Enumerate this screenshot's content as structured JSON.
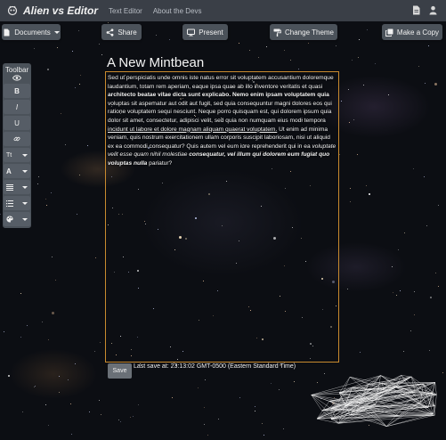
{
  "nav": {
    "brand": "Alien vs Editor",
    "links": [
      "Text Editor",
      "About the Devs"
    ],
    "icons": [
      "document-icon",
      "user-icon"
    ]
  },
  "actions": {
    "documents": "Documents",
    "share": "Share",
    "present": "Present",
    "change_theme": "Change Theme",
    "make_copy": "Make a Copy"
  },
  "toolbar": {
    "title": "Toolbar",
    "bold": "B",
    "italic": "I",
    "underline": "U",
    "font_size": "Tt",
    "font_color": "A"
  },
  "document": {
    "title": "A New Mintbean",
    "segments": [
      {
        "style": "normal",
        "text": "Sed ut perspiciatis unde omnis iste natus error sit voluptatem accusantium doloremque laudantium, totam rem aperiam, eaque ipsa quae ab illo inventore veritatis et quasi "
      },
      {
        "style": "bold",
        "text": "architecto beatae vitae dicta sunt explicabo. Nemo enim ipsam voluptatem quia"
      },
      {
        "style": "normal",
        "text": " voluptas sit aspernatur aut odit aut fugit, sed quia consequuntur magni dolores eos qui ratione voluptatem sequi nesciunt. Neque porro quisquam est, qui dolorem ipsum quia dolor sit amet, consectetur, adipisci velit, sed quia non numquam eius modi tempora "
      },
      {
        "style": "underline",
        "text": "incidunt ut labore et dolore magnam aliquam quaerat voluptatem."
      },
      {
        "style": "normal",
        "text": " Ut enim ad minima veniam, quis nostrum exercitationem ullam corporis suscipit laboriosam, nisi ut aliquid ex ea commodi consequatur? Quis autem vel eum iure reprehenderit qui in ea "
      },
      {
        "style": "italic",
        "text": "voluptate velit esse quam nihil molestiae"
      },
      {
        "style": "bolditalic",
        "text": " consequatur, vel illum qui dolorem eum fugiat quo voluptas nulla"
      },
      {
        "style": "normal",
        "text": " pariatur?"
      }
    ]
  },
  "footer": {
    "save": "Save",
    "last_save": "Last save at: 23:13:02 GMT-0500 (Eastern Standard Time)"
  },
  "colors": {
    "navbar": "#3a3f47",
    "button": "#4b525a",
    "editor_border": "#c98a2e"
  }
}
